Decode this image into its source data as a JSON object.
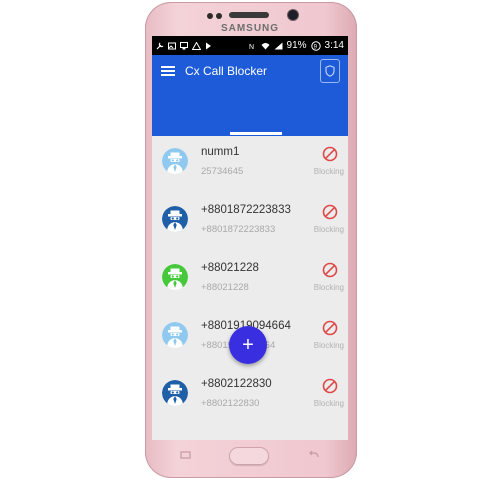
{
  "device": {
    "brand": "SAMSUNG"
  },
  "status_bar": {
    "battery": "91%",
    "time": "3:14",
    "icons": [
      "wrench-icon",
      "image-icon",
      "cast-icon",
      "warning-icon",
      "play-icon",
      "nfc-icon",
      "wifi-icon",
      "signal-icon",
      "battery-icon"
    ]
  },
  "app_bar": {
    "title": "Cx Call Blocker",
    "menu_icon": "hamburger-menu-icon",
    "action_icon": "shield-icon",
    "color": "#1e5bd9"
  },
  "blocked_list": [
    {
      "name": "numm1",
      "number": "25734645",
      "status": "Blocking",
      "avatar_color": "#8fc9ef"
    },
    {
      "name": "+8801872223833",
      "number": "+8801872223833",
      "status": "Blocking",
      "avatar_color": "#1f5fa8"
    },
    {
      "name": "+88021228",
      "number": "+88021228",
      "status": "Blocking",
      "avatar_color": "#45c93a"
    },
    {
      "name": "+8801919094664",
      "number": "+8801919094664",
      "status": "Blocking",
      "avatar_color": "#8fc9ef"
    },
    {
      "name": "+8802122830",
      "number": "+8802122830",
      "status": "Blocking",
      "avatar_color": "#1f5fa8"
    }
  ],
  "fab": {
    "label": "+",
    "color": "#3a2fe0"
  },
  "colors": {
    "block_icon": "#e04848"
  }
}
